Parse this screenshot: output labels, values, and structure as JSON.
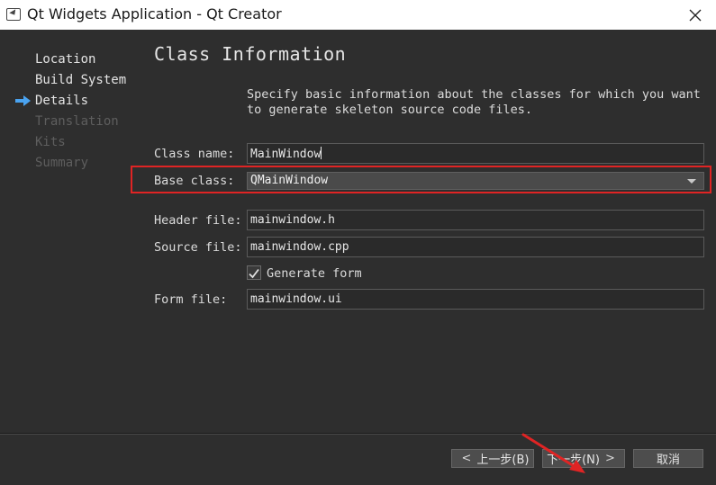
{
  "window": {
    "title": "Qt Widgets Application - Qt Creator"
  },
  "steps": [
    {
      "label": "Location",
      "state": "done"
    },
    {
      "label": "Build System",
      "state": "done"
    },
    {
      "label": "Details",
      "state": "current"
    },
    {
      "label": "Translation",
      "state": "todo"
    },
    {
      "label": "Kits",
      "state": "todo"
    },
    {
      "label": "Summary",
      "state": "todo"
    }
  ],
  "page": {
    "heading": "Class Information",
    "description": "Specify basic information about the classes for which you want to generate skeleton source code files."
  },
  "form": {
    "class_name_label": "Class name:",
    "class_name_value": "MainWindow",
    "base_class_label": "Base class:",
    "base_class_value": "QMainWindow",
    "header_file_label": "Header file:",
    "header_file_value": "mainwindow.h",
    "source_file_label": "Source file:",
    "source_file_value": "mainwindow.cpp",
    "generate_form_label": "Generate form",
    "generate_form_checked": true,
    "form_file_label": "Form file:",
    "form_file_value": "mainwindow.ui"
  },
  "buttons": {
    "back_label": "上一步(B)",
    "next_label": "下一步(N)",
    "cancel_label": "取消",
    "back_chevron": "<",
    "next_chevron": ">"
  },
  "colors": {
    "highlight_annotation": "#e02424",
    "current_step_arrow": "#4aa3f0"
  }
}
